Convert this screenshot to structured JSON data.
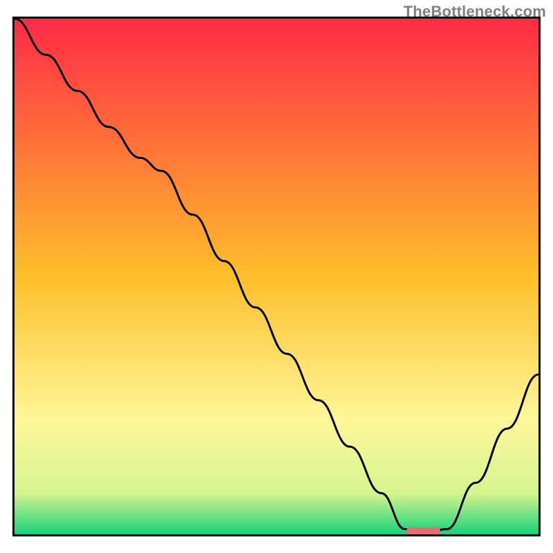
{
  "watermark": "TheBottleneck.com",
  "chart_data": {
    "type": "line",
    "title": "",
    "xlabel": "",
    "ylabel": "",
    "xlim": [
      0,
      100
    ],
    "ylim": [
      0,
      100
    ],
    "grid": false,
    "legend": false,
    "background_gradient": {
      "stops": [
        {
          "offset": 0.0,
          "color": "#ff2a46"
        },
        {
          "offset": 0.5,
          "color": "#ffbf2b"
        },
        {
          "offset": 0.78,
          "color": "#fff79a"
        },
        {
          "offset": 0.92,
          "color": "#d6f58f"
        },
        {
          "offset": 1.0,
          "color": "#16d27a"
        }
      ]
    },
    "series": [
      {
        "name": "bottleneck-curve",
        "color": "#000000",
        "x": [
          0,
          6,
          12,
          18,
          24,
          28,
          34,
          40,
          46,
          52,
          58,
          64,
          70,
          74.5,
          78,
          82.5,
          88,
          94,
          100
        ],
        "y": [
          100,
          93,
          86,
          79,
          73,
          70.5,
          62,
          53,
          44,
          35,
          26,
          17,
          8,
          1,
          0,
          1,
          10,
          20.5,
          31
        ]
      }
    ],
    "optimal_marker": {
      "name": "optimal-zone",
      "x_center": 78,
      "x_width": 6.5,
      "y": 0.6,
      "color": "#e27072"
    }
  }
}
